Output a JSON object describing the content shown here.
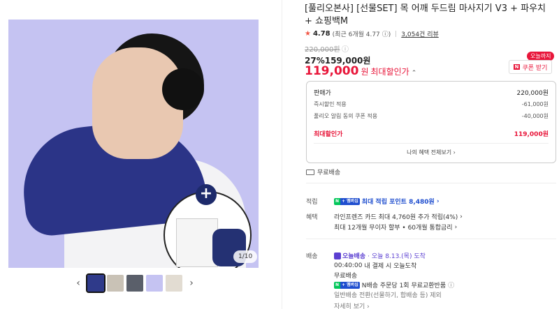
{
  "gallery": {
    "counter": "1/10",
    "prev_arrow": "‹",
    "next_arrow": "›",
    "thumb_colors": [
      "#2f3a8a",
      "#c9c2b6",
      "#5a5f6a",
      "#c5c3f2",
      "#e2dcd2"
    ]
  },
  "product": {
    "title": "[풀리오본사] [선물SET] 목 어깨 두드림 마사지기 V3 + 파우치 + 쇼핑백M",
    "rating_star": "★",
    "rating_score": "4.78",
    "rating_recent": "(최근 6개월 4.77",
    "rating_info": "ⓘ)",
    "reviews": "3,054건 리뷰",
    "original_price": "220,000원",
    "original_price_info_icon": "ⓘ",
    "discount_rate": "27%",
    "sale_price": "159,000원",
    "max_price_amount": "119,000",
    "max_price_unit": "원",
    "max_price_label": "최대할인가",
    "max_price_chevron": "⌃",
    "today_only_badge": "오늘까지",
    "coupon_icon": "N",
    "coupon_label": "쿠폰 받기"
  },
  "price_box": {
    "rows": [
      {
        "label": "판매가",
        "value": "220,000원"
      },
      {
        "label": "즉시할인 적용",
        "value": "-61,000원"
      },
      {
        "label": "풀리오 알림 동의 쿠폰 적용",
        "value": "-40,000원"
      }
    ],
    "max_label": "최대할인가",
    "max_value": "119,000원",
    "benefit_link": "나의 혜택 전체보기 ›"
  },
  "shipping_free": "무료배송",
  "points": {
    "label": "적립",
    "npay_n": "N",
    "npay_plus": "+ 멤버십",
    "text": "최대 적립 포인트 8,480원",
    "chevron": "›"
  },
  "benefits": {
    "label": "혜택",
    "line1": "라인프렌즈 카드 최대 4,760원 추가 적립(4%)",
    "line2": "최대 12개월 무이자 할부 • 60개월 통합금리",
    "chevron": "›"
  },
  "delivery": {
    "label": "배송",
    "today_tag": "오늘배송",
    "today_info": "· 오늘 8.13.(목) 도착",
    "deadline_time": "00:40:00",
    "deadline_text": "내 결제 시 오늘도착",
    "free": "무료배송",
    "npay_n": "N",
    "npay_plus": "+ 멤버십",
    "npay_text": "N배송 주문당 1회 무료교환반품",
    "info_icon": "ⓘ",
    "normal": "일반배송 전환(선물하기, 합배송 등) 제외",
    "more": "자세히 보기 ›"
  },
  "colors": {
    "accent_red": "#e8163a",
    "npay_green": "#03c75a",
    "npay_blue": "#1f4ecf",
    "today_purple": "#5b3fd1",
    "hero_bg": "#c5c3f2"
  }
}
